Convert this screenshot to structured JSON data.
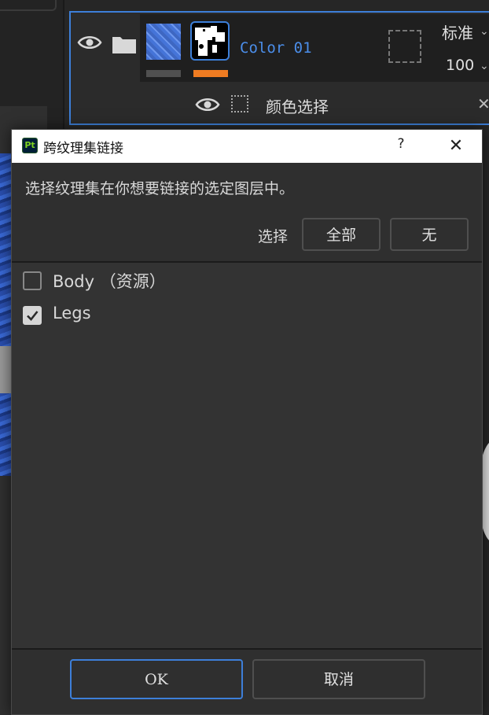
{
  "background_app": {
    "layer": {
      "name": "Color 01",
      "blend_mode": "标准",
      "opacity": "100",
      "sub_layer_name": "颜色选择"
    }
  },
  "dialog": {
    "title": "跨纹理集链接",
    "app_logo_text": "Pt",
    "help_label": "?",
    "close_label": "✕",
    "instruction": "选择纹理集在你想要链接的选定图层中。",
    "select_label": "选择",
    "select_all_label": "全部",
    "select_none_label": "无",
    "texture_sets": [
      {
        "label": "Body （资源）",
        "checked": false
      },
      {
        "label": "Legs",
        "checked": true
      }
    ],
    "ok_label": "OK",
    "cancel_label": "取消"
  },
  "colors": {
    "accent": "#3d7fd9",
    "mask_bar": "#ef7c22",
    "dialog_bg": "#2f2f2f",
    "titlebar_bg": "#ffffff"
  }
}
